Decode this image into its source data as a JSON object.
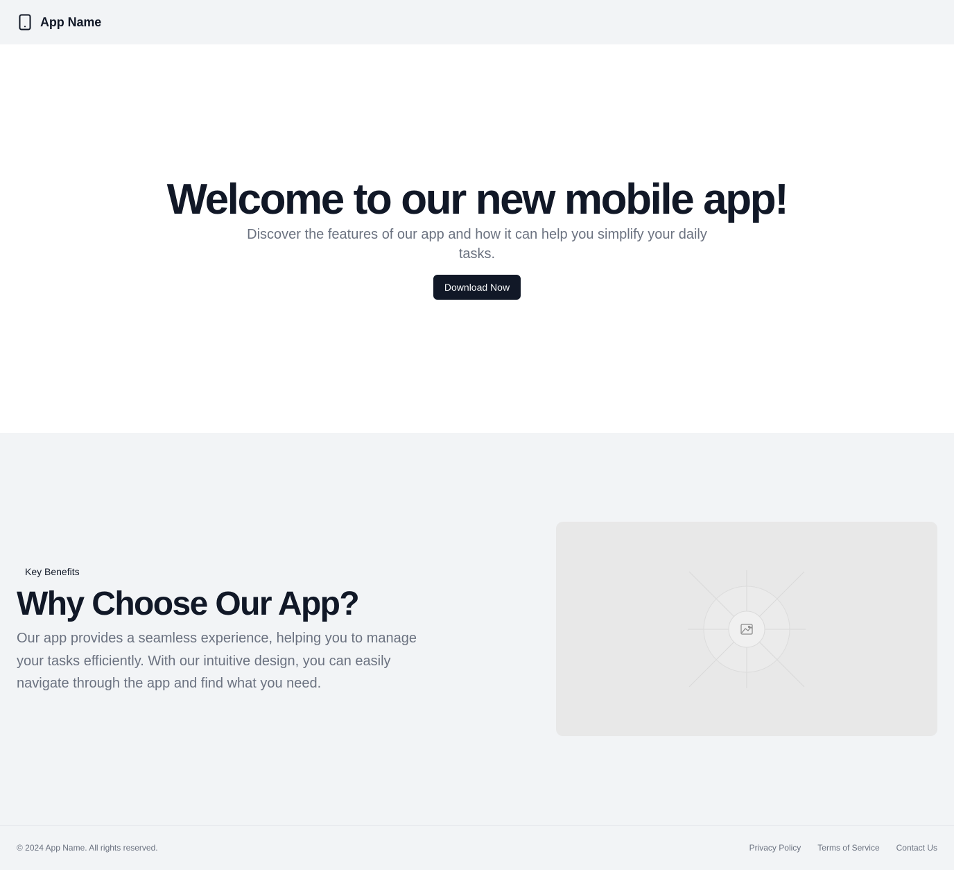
{
  "header": {
    "logo_icon": "smartphone-icon",
    "app_name": "App Name"
  },
  "hero": {
    "title": "Welcome to our new mobile app!",
    "subtitle": "Discover the features of our app and how it can help you simplify your daily tasks.",
    "cta_label": "Download Now"
  },
  "benefits": {
    "tag": "Key Benefits",
    "title": "Why Choose Our App?",
    "description": "Our app provides a seamless experience, helping you to manage your tasks efficiently. With our intuitive design, you can easily navigate through the app and find what you need.",
    "image_icon": "image-placeholder-icon"
  },
  "footer": {
    "copyright": "© 2024 App Name. All rights reserved.",
    "links": [
      "Privacy Policy",
      "Terms of Service",
      "Contact Us"
    ]
  },
  "colors": {
    "primary": "#111827",
    "muted_text": "#6b7280",
    "page_background": "#f2f4f6",
    "hero_background": "#ffffff",
    "placeholder_background": "#e8e8e8"
  }
}
